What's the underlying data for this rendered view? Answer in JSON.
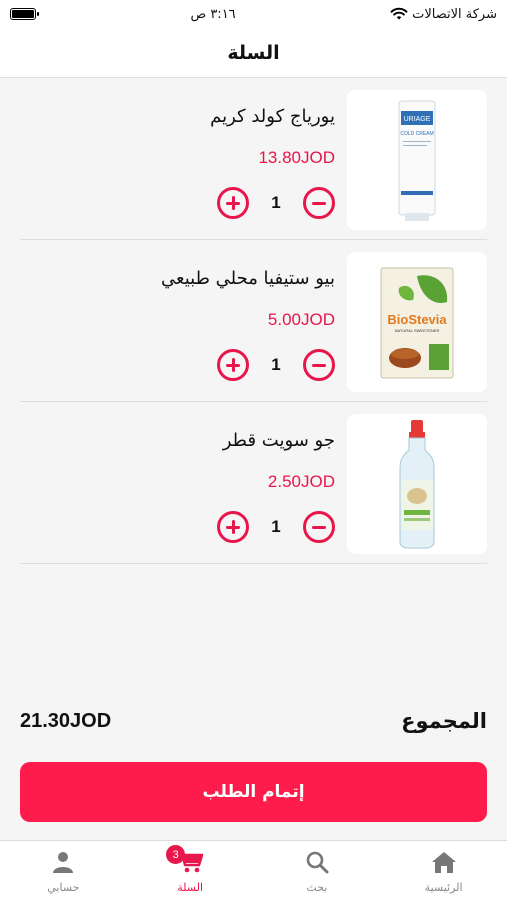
{
  "status_bar": {
    "carrier": "شركة الاتصالات",
    "time": "٣:١٦ ص"
  },
  "header": {
    "title": "السلة"
  },
  "cart": {
    "items": [
      {
        "name": "يورياج كولد كريم",
        "price": "13.80JOD",
        "quantity": "1",
        "product_label": "URIAGE",
        "product_sub": "COLD CREAM"
      },
      {
        "name": "بيو ستيفيا محلي طبيعي",
        "price": "5.00JOD",
        "quantity": "1",
        "product_label": "BioStevia",
        "product_sub": "NATURAL SWEETENER"
      },
      {
        "name": "جو سويت قطر",
        "price": "2.50JOD",
        "quantity": "1"
      }
    ]
  },
  "summary": {
    "total_label": "المجموع",
    "total_value": "21.30JOD"
  },
  "checkout": {
    "label": "إتمام الطلب"
  },
  "tabbar": {
    "items": [
      {
        "label": "حسابي",
        "icon": "person-icon"
      },
      {
        "label": "السلة",
        "icon": "cart-icon",
        "badge": "3",
        "active": true
      },
      {
        "label": "بحث",
        "icon": "search-icon"
      },
      {
        "label": "الرئيسية",
        "icon": "home-icon"
      }
    ]
  },
  "colors": {
    "accent": "#e8164b",
    "button": "#fd1c4c",
    "background": "#f5f5f5"
  }
}
